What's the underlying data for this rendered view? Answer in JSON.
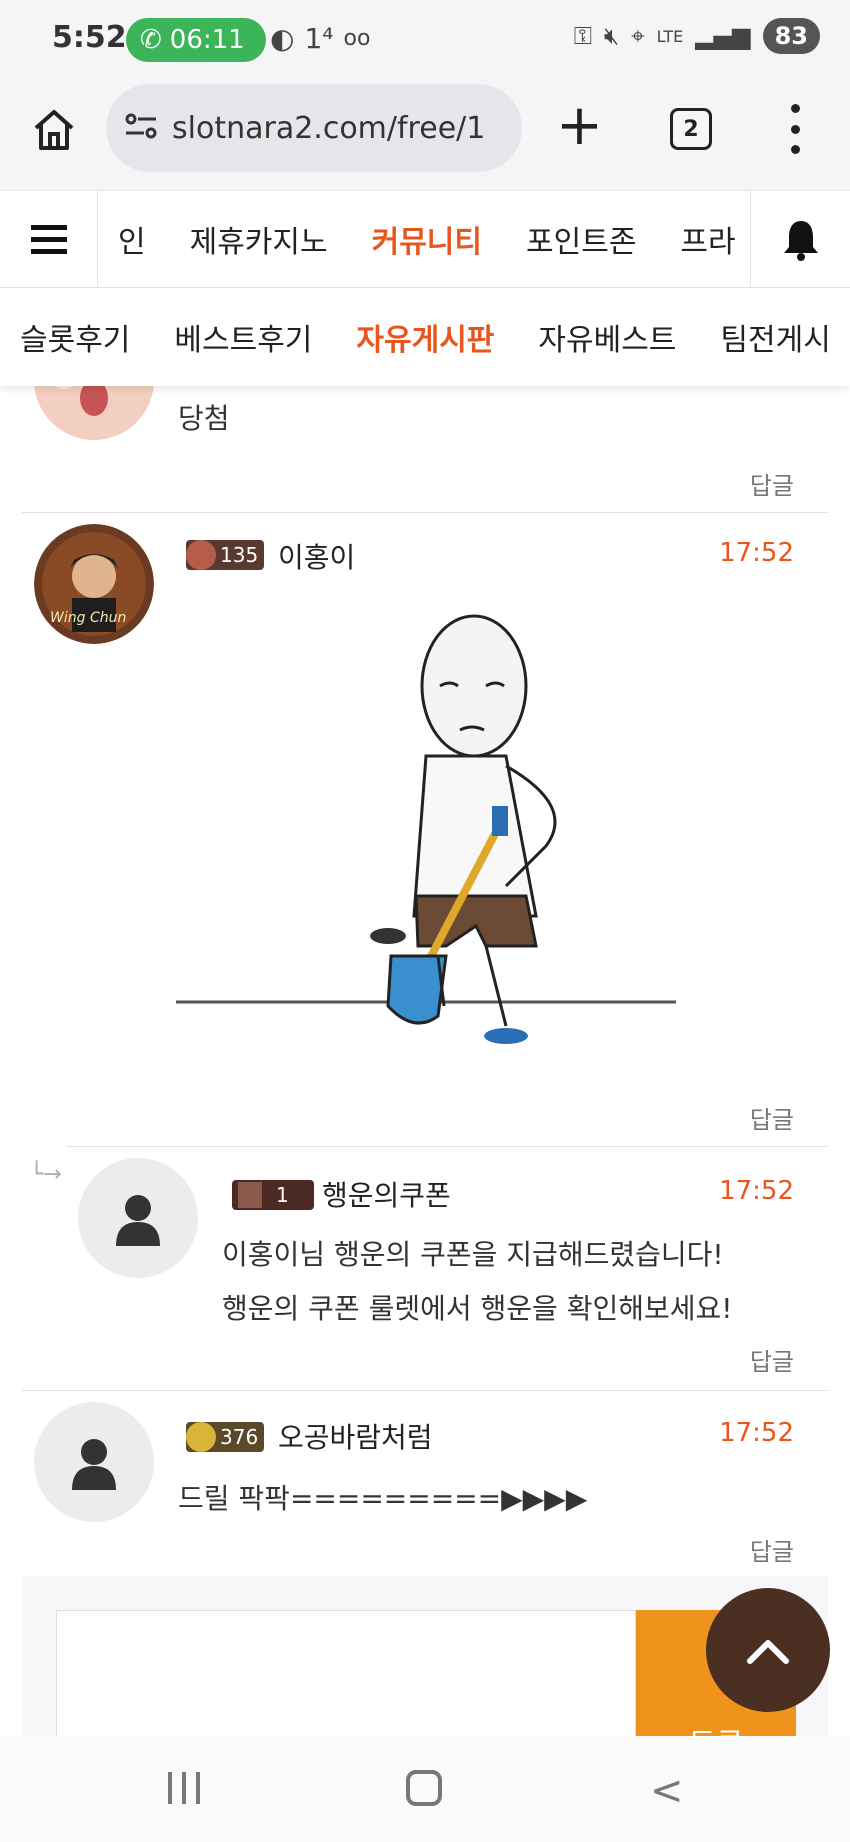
{
  "status_bar": {
    "time": "5:52",
    "call_timer": "06:11",
    "badge": "1⁴",
    "battery": "83",
    "network": "LTE"
  },
  "browser": {
    "url": "slotnara2.com/free/1",
    "tab_count": "2"
  },
  "site_nav": {
    "items": [
      "인",
      "제휴카지노",
      "커뮤니티",
      "포인트존",
      "프라"
    ],
    "active_index": 2
  },
  "sub_nav": {
    "items": [
      "슬롯후기",
      "베스트후기",
      "자유게시판",
      "자유베스트",
      "팀전게시"
    ],
    "active_index": 2
  },
  "comments": [
    {
      "text": "당첨",
      "reply_label": "답글"
    },
    {
      "level": "135",
      "author": "이홍이",
      "time": "17:52",
      "has_image": true,
      "avatar_caption": "Wing Chun",
      "reply_label": "답글"
    },
    {
      "is_reply": true,
      "level": "1",
      "author": "행운의쿠폰",
      "time": "17:52",
      "lines": [
        "이홍이님 행운의 쿠폰을 지급해드렸습니다!",
        "행운의 쿠폰 룰렛에서 행운을 확인해보세요!"
      ],
      "reply_label": "답글"
    },
    {
      "level": "376",
      "author": "오공바람처럼",
      "time": "17:52",
      "text": "드릴 팍팍=========▶▶▶▶",
      "reply_label": "답글"
    }
  ],
  "editor": {
    "submit_label": "등록"
  },
  "colors": {
    "accent": "#e8561e",
    "submit": "#f0931c",
    "scroll_top": "#4a2f22"
  }
}
